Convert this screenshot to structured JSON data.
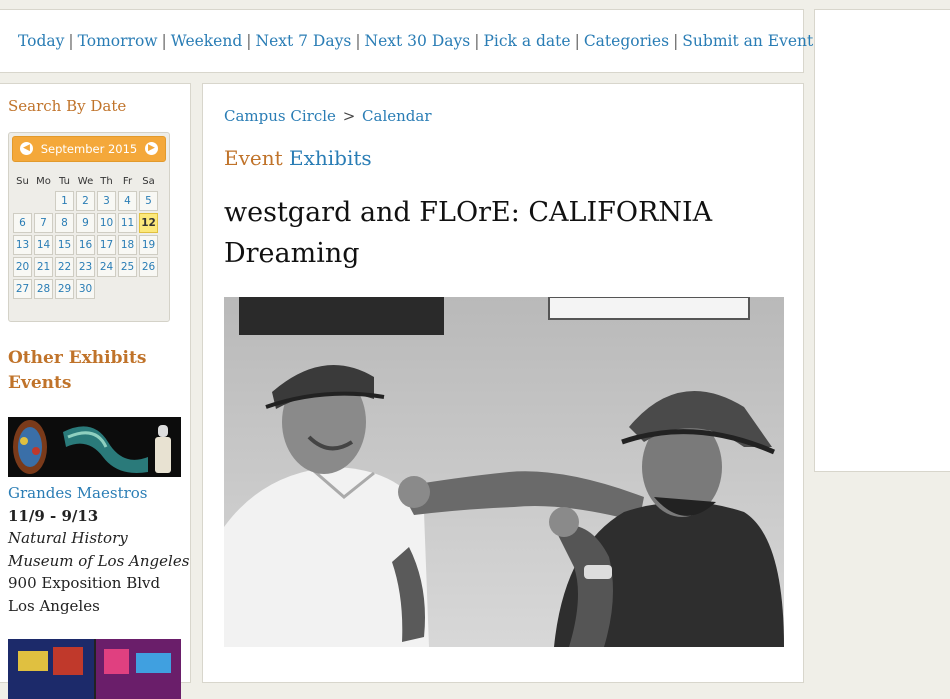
{
  "topnav": {
    "links": [
      "Today",
      "Tomorrow",
      "Weekend",
      "Next 7 Days",
      "Next 30 Days",
      "Pick a date",
      "Categories",
      "Submit an Event"
    ]
  },
  "sidebar": {
    "search_title": "Search By Date",
    "calendar": {
      "month_label": "September 2015",
      "weekdays": [
        "Su",
        "Mo",
        "Tu",
        "We",
        "Th",
        "Fr",
        "Sa"
      ],
      "selected_day": "12",
      "weeks": [
        [
          "",
          "",
          "1",
          "2",
          "3",
          "4",
          "5"
        ],
        [
          "6",
          "7",
          "8",
          "9",
          "10",
          "11",
          "12"
        ],
        [
          "13",
          "14",
          "15",
          "16",
          "17",
          "18",
          "19"
        ],
        [
          "20",
          "21",
          "22",
          "23",
          "24",
          "25",
          "26"
        ],
        [
          "27",
          "28",
          "29",
          "30",
          "",
          "",
          ""
        ]
      ]
    },
    "other_title_line1": "Other Exhibits",
    "other_title_line2": "Events",
    "event": {
      "name": "Grandes Maestros",
      "dates": "11/9 - 9/13",
      "venue_line1": "Natural History",
      "venue_line2": "Museum of Los Angeles",
      "address": "900 Exposition Blvd",
      "city": "Los Angeles"
    }
  },
  "main": {
    "breadcrumb": {
      "home": "Campus Circle",
      "separator": ">",
      "current": "Calendar"
    },
    "category_word1": "Event",
    "category_word2": "Exhibits",
    "title": "westgard and FLOrE: CALIFORNIA Dreaming"
  },
  "colors": {
    "link": "#2a7db5",
    "heading_orange": "#c0732a",
    "calendar_header": "#f4a83a",
    "today_highlight": "#fce87a"
  }
}
